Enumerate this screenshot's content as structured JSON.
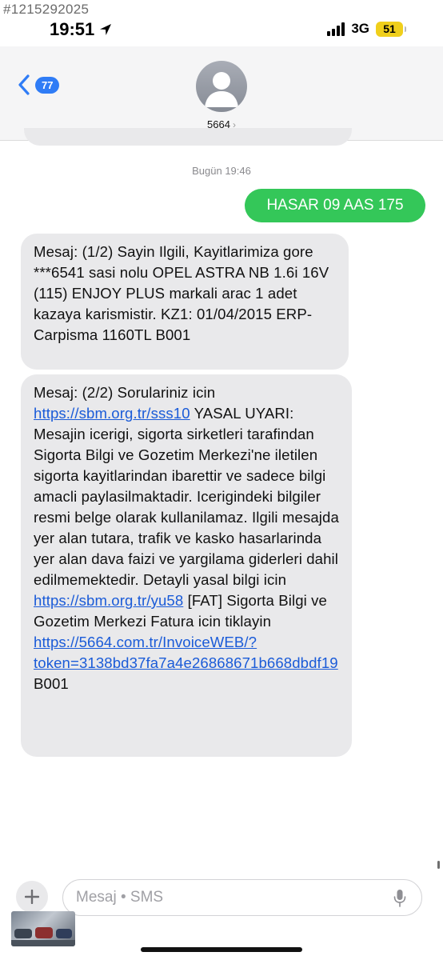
{
  "overlay": {
    "id_text": "#1215292025"
  },
  "status_bar": {
    "time": "19:51",
    "network": "3G",
    "battery_level": "51",
    "icons": [
      "location-arrow-icon",
      "signal-bars-icon",
      "battery-icon"
    ]
  },
  "header": {
    "back_badge": "77",
    "contact_name": "5664",
    "icons": [
      "back-chevron-icon",
      "contact-avatar-icon",
      "chevron-right-icon"
    ]
  },
  "conversation": {
    "timestamp": "Bugün 19:46",
    "sent_message": "HASAR 09 AAS 175",
    "received_1": "Mesaj: (1/2) Sayin Ilgili, Kayitlarimiza gore ***6541 sasi nolu OPEL ASTRA NB 1.6i 16V (115) ENJOY PLUS markali arac 1 adet kazaya karismistir. KZ1: 01/04/2015 ERP-Carpisma 1160TL B001",
    "received_2": {
      "part_a": "Mesaj: (2/2) Sorulariniz icin ",
      "link_a": "https://sbm.org.tr/sss10",
      "part_b": " YASAL UYARI: Mesajin icerigi, sigorta sirketleri tarafindan Sigorta Bilgi ve Gozetim Merkezi'ne iletilen sigorta kayitlarindan ibarettir ve sadece bilgi amacli paylasilmaktadir. Icerigindeki bilgiler resmi belge olarak kullanilamaz. Ilgili mesajda yer alan tutara, trafik ve kasko hasarlarinda yer alan dava faizi ve yargilama giderleri dahil edilmemektedir. Detayli yasal bilgi icin ",
      "link_b": "https://sbm.org.tr/yu58",
      "part_c": " [FAT] Sigorta Bilgi ve Gozetim Merkezi Fatura icin tiklayin ",
      "link_c": "https://5664.com.tr/InvoiceWEB/?token=3138bd37fa7a4e26868671b668dbdf19",
      "part_d": " B001"
    }
  },
  "input_bar": {
    "placeholder": "Mesaj • SMS",
    "icons": [
      "plus-icon",
      "microphone-icon"
    ]
  },
  "colors": {
    "sent_bubble": "#34c759",
    "received_bubble": "#e9e9eb",
    "link": "#1a5bd8",
    "accent_blue": "#2f7cf6",
    "battery": "#f0cf1b"
  }
}
